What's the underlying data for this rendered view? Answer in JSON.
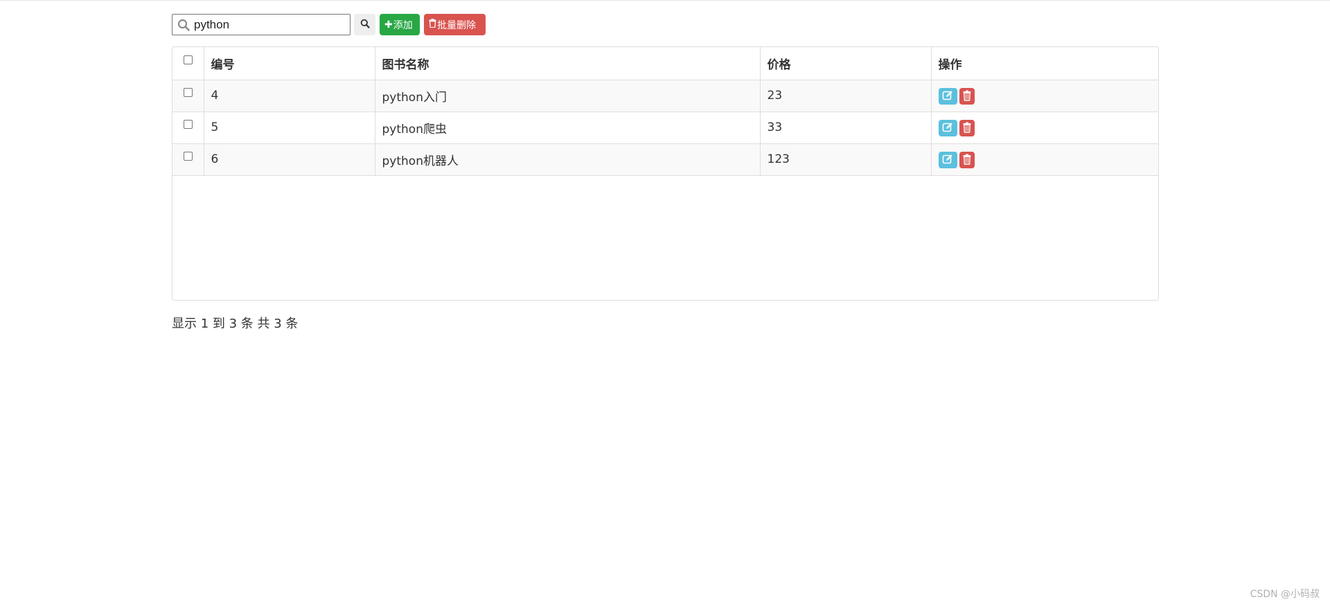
{
  "toolbar": {
    "search_value": "python",
    "add_label": "添加",
    "batch_delete_label": "批量删除"
  },
  "table": {
    "headers": [
      "编号",
      "图书名称",
      "价格",
      "操作"
    ],
    "rows": [
      {
        "id": "4",
        "name": "python入门",
        "price": "23"
      },
      {
        "id": "5",
        "name": "python爬虫",
        "price": "33"
      },
      {
        "id": "6",
        "name": "python机器人",
        "price": "123"
      }
    ]
  },
  "pagination": {
    "summary": "显示 1 到 3 条 共 3 条"
  },
  "watermark": "CSDN @小码叔",
  "colors": {
    "add": "#28a745",
    "delete": "#d9534f",
    "edit": "#5bc0de"
  },
  "icons": [
    "search-icon",
    "plus-icon",
    "trash-icon",
    "edit-icon"
  ]
}
